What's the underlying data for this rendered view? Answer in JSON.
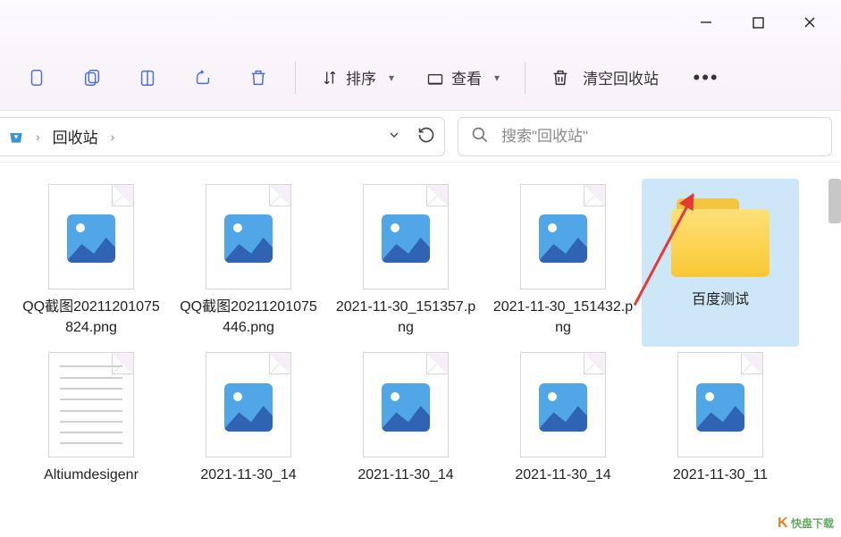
{
  "window": {
    "location_name": "回收站"
  },
  "toolbar": {
    "sort_label": "排序",
    "view_label": "查看",
    "empty_label": "清空回收站"
  },
  "search": {
    "placeholder": "搜索\"回收站\""
  },
  "items": [
    {
      "name": "QQ截图20211201075824.png",
      "type": "image"
    },
    {
      "name": "QQ截图20211201075446.png",
      "type": "image"
    },
    {
      "name": "2021-11-30_151357.png",
      "type": "image"
    },
    {
      "name": "2021-11-30_151432.png",
      "type": "image"
    },
    {
      "name": "百度测试",
      "type": "folder",
      "selected": true
    },
    {
      "name": "Altiumdesigenr",
      "type": "text"
    },
    {
      "name": "2021-11-30_14",
      "type": "image"
    },
    {
      "name": "2021-11-30_14",
      "type": "image"
    },
    {
      "name": "2021-11-30_14",
      "type": "image"
    },
    {
      "name": "2021-11-30_11",
      "type": "image"
    }
  ],
  "watermark": "快盘下载"
}
